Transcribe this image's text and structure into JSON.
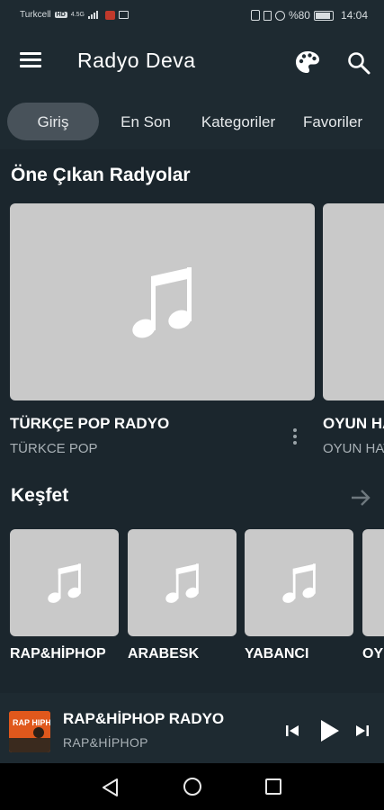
{
  "status_bar": {
    "carrier": "Turkcell",
    "network_badge": "HD",
    "network_type": "4.5G",
    "battery": "%80",
    "time": "14:04"
  },
  "app_bar": {
    "title": "Radyo Deva",
    "icons": [
      "menu-icon",
      "palette-icon",
      "search-icon"
    ]
  },
  "tabs": [
    {
      "label": "Giriş",
      "active": true
    },
    {
      "label": "En Son",
      "active": false
    },
    {
      "label": "Kategoriler",
      "active": false
    },
    {
      "label": "Favoriler",
      "active": false
    }
  ],
  "featured": {
    "title": "Öne Çıkan Radyolar",
    "items": [
      {
        "name": "TÜRKÇE POP RADYO",
        "subtitle": "TÜRKCE POP"
      },
      {
        "name": "OYUN HAVALARI RADYO",
        "subtitle": "OYUN HAVALARI"
      }
    ]
  },
  "explore": {
    "title": "Keşfet",
    "items": [
      {
        "name": "RAP&HİPHOP"
      },
      {
        "name": "ARABESK"
      },
      {
        "name": "YABANCI"
      },
      {
        "name": "OYUN HAVALARI"
      }
    ]
  },
  "player": {
    "title": "RAP&HİPHOP RADYO",
    "subtitle": "RAP&HİPHOP",
    "art_text": "RAP HIPHOP"
  },
  "colors": {
    "background": "#1b262d",
    "bar": "#1e2a31",
    "placeholder": "#c9c9c9",
    "active_tab": "#48525a",
    "secondary_text": "#a9b1b6"
  }
}
